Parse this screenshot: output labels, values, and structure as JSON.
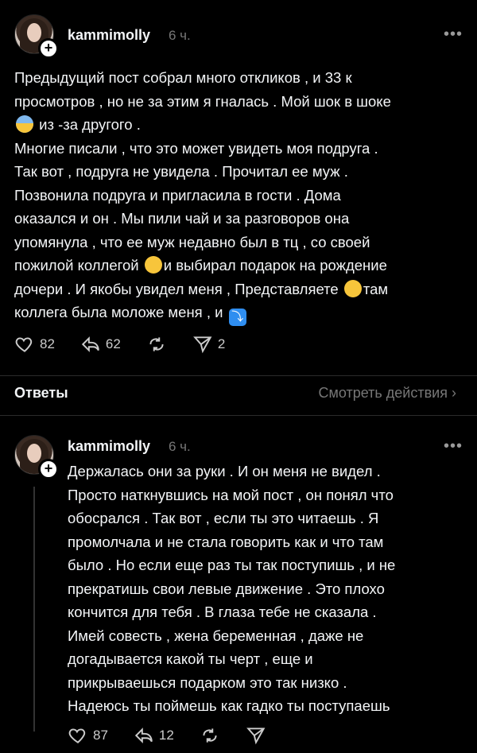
{
  "post1": {
    "username": "kammimolly",
    "time": "6 ч.",
    "text_lines": [
      "Предыдущий пост собрал много  откликов , и 33 к",
      "просмотров , но не за этим я гналась . Мой шок в шоке",
      "из -за другого .",
      "Многие писали , что это  может увидеть моя подруга .",
      "Так вот , подруга не увидела . Прочитал ее муж .",
      "Позвонила подруга и пригласила в гости . Дома",
      "оказался и он . Мы пили чай и за разговоров она",
      "упомянула , что ее муж недавно был в тц , со своей",
      "пожилой коллегой",
      "и выбирал подарок на рождение",
      "дочери .  И якобы увидел меня , Представляете",
      "там",
      "коллега была моложе меня , и"
    ],
    "likes": "82",
    "replies": "62",
    "shares": "2"
  },
  "section": {
    "title": "Ответы",
    "link": "Смотреть действия"
  },
  "post2": {
    "username": "kammimolly",
    "time": "6 ч.",
    "text": "Держалась они за руки .  И он меня не видел .\nПросто наткнувшись на мой пост , он понял что\nобосрался . Так вот , если ты это читаешь . Я\nпромолчала и не стала говорить как и что там\nбыло . Но  если еще раз ты так поступишь , и не\nпрекратишь свои левые движение . Это плохо\nкончится для тебя . В глаза тебе не сказала .\nИмей совесть , жена беременная , даже не\nдогадывается какой ты черт , еще и\nприкрываешься подарком это так низко .\nНадеюсь ты поймешь как гадко ты поступаешь",
    "likes": "87",
    "replies": "12"
  },
  "icons": [
    "heart-icon",
    "reply-icon",
    "repost-icon",
    "share-icon",
    "more-icon",
    "chevron-right-icon",
    "plus-icon"
  ],
  "colors": {
    "background": "#000000",
    "text": "#f3f5f7",
    "muted": "#777777"
  }
}
